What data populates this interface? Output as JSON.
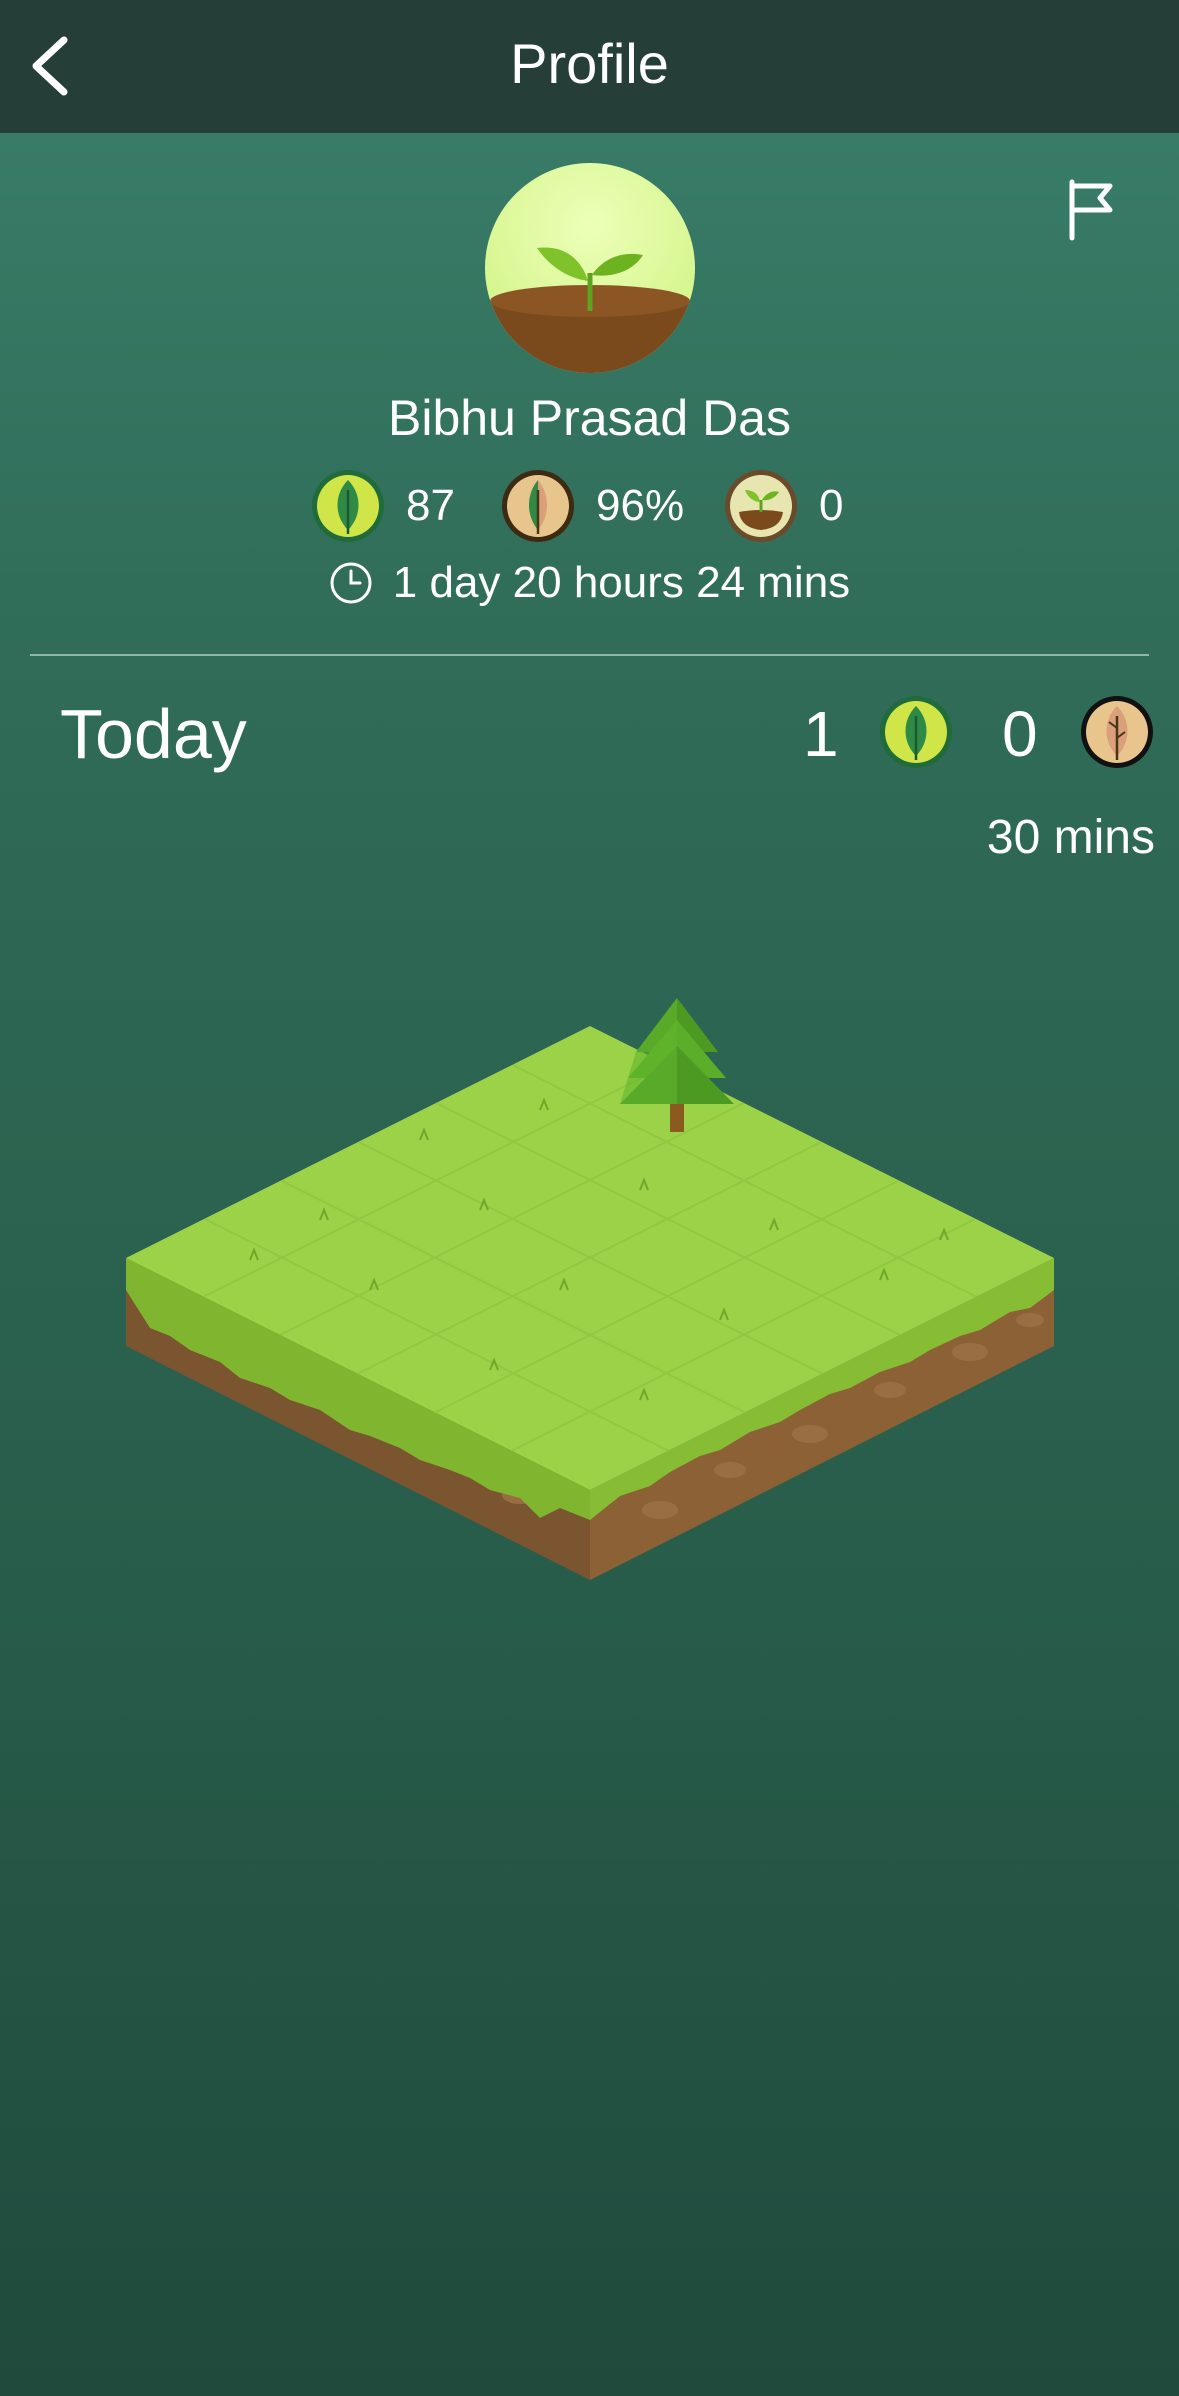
{
  "header": {
    "title": "Profile"
  },
  "profile": {
    "name": "Bibhu Prasad Das"
  },
  "stats": {
    "healthy_trees": "87",
    "success_rate": "96%",
    "seeds": "0",
    "focus_time": "1 day 20 hours 24 mins"
  },
  "today": {
    "label": "Today",
    "healthy_count": "1",
    "dead_count": "0",
    "duration": "30 mins"
  },
  "icons": {
    "back": "chevron-left-icon",
    "flag": "flag-icon",
    "healthy_tree": "green-leaf-icon",
    "dead_tree": "withered-leaf-icon",
    "seed": "sprout-icon",
    "clock": "clock-icon"
  },
  "colors": {
    "topbar": "#263e38",
    "background": "#2f6b57",
    "healthy_badge": "#cfe548",
    "dead_badge": "#e9c58e",
    "grass": "#9bd247",
    "soil": "#7a5530"
  }
}
